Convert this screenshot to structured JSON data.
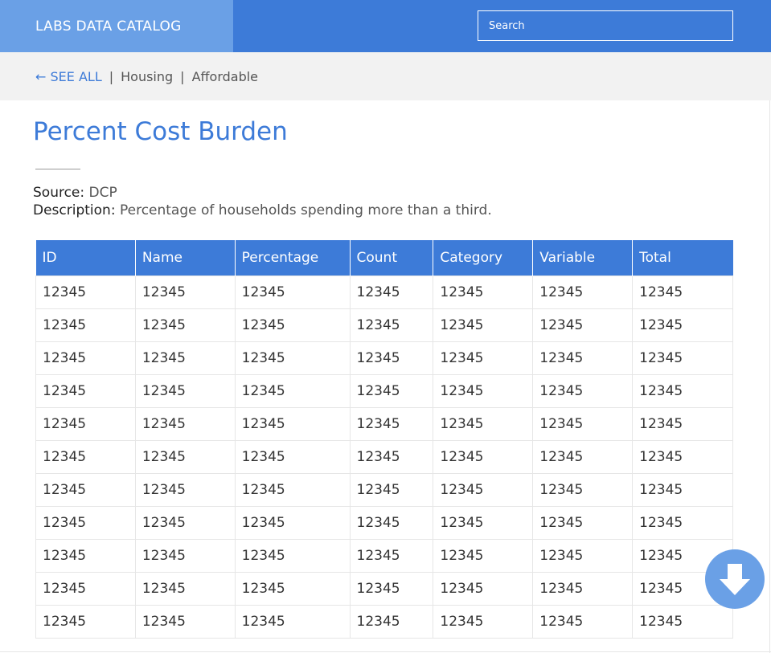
{
  "header": {
    "brand": "LABS DATA CATALOG",
    "search_placeholder": "Search"
  },
  "breadcrumb": {
    "back_label": "← SEE ALL",
    "separator": "|",
    "items": [
      "Housing",
      "Affordable"
    ]
  },
  "dataset": {
    "title": "Percent Cost Burden",
    "source_key": "Source:",
    "source_value": "DCP",
    "description_key": "Description:",
    "description_value": "Percentage of households spending more than a third."
  },
  "table": {
    "columns": [
      "ID",
      "Name",
      "Percentage",
      "Count",
      "Category",
      "Variable",
      "Total"
    ],
    "rows": [
      [
        "12345",
        "12345",
        "12345",
        "12345",
        "12345",
        "12345",
        "12345"
      ],
      [
        "12345",
        "12345",
        "12345",
        "12345",
        "12345",
        "12345",
        "12345"
      ],
      [
        "12345",
        "12345",
        "12345",
        "12345",
        "12345",
        "12345",
        "12345"
      ],
      [
        "12345",
        "12345",
        "12345",
        "12345",
        "12345",
        "12345",
        "12345"
      ],
      [
        "12345",
        "12345",
        "12345",
        "12345",
        "12345",
        "12345",
        "12345"
      ],
      [
        "12345",
        "12345",
        "12345",
        "12345",
        "12345",
        "12345",
        "12345"
      ],
      [
        "12345",
        "12345",
        "12345",
        "12345",
        "12345",
        "12345",
        "12345"
      ],
      [
        "12345",
        "12345",
        "12345",
        "12345",
        "12345",
        "12345",
        "12345"
      ],
      [
        "12345",
        "12345",
        "12345",
        "12345",
        "12345",
        "12345",
        "12345"
      ],
      [
        "12345",
        "12345",
        "12345",
        "12345",
        "12345",
        "12345",
        "12345"
      ],
      [
        "12345",
        "12345",
        "12345",
        "12345",
        "12345",
        "12345",
        "12345"
      ]
    ]
  },
  "download_button": {
    "icon": "download-arrow-icon"
  },
  "colors": {
    "primary": "#3d7bd8",
    "brand_bg": "#6aa0e6",
    "crumb_bg": "#f2f2f2"
  }
}
